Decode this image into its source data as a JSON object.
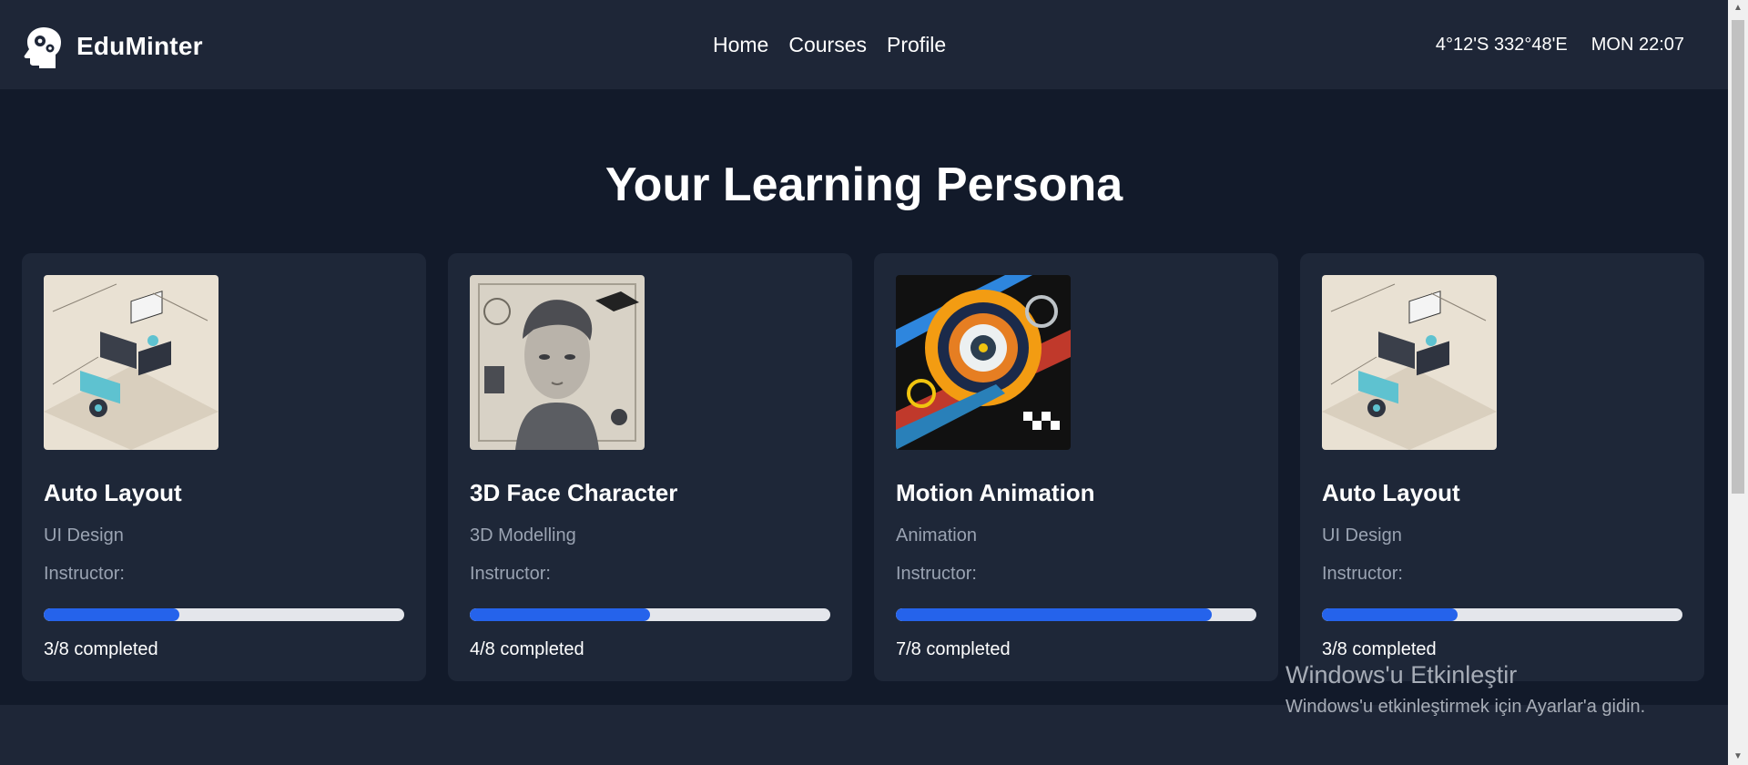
{
  "app": {
    "brand_name": "EduMinter"
  },
  "nav": {
    "links": [
      "Home",
      "Courses",
      "Profile"
    ]
  },
  "status": {
    "coordinates": "4°12'S 332°48'E",
    "day_time": "MON 22:07"
  },
  "page": {
    "title": "Your Learning Persona"
  },
  "courses": [
    {
      "title": "Auto Layout",
      "category": "UI Design",
      "instructor_label": "Instructor:",
      "progress": 0.375,
      "completed_text": "3/8 completed",
      "image": "auto-layout-illustration"
    },
    {
      "title": "3D Face Character",
      "category": "3D Modelling",
      "instructor_label": "Instructor:",
      "progress": 0.5,
      "completed_text": "4/8 completed",
      "image": "3d-face-illustration"
    },
    {
      "title": "Motion Animation",
      "category": "Animation",
      "instructor_label": "Instructor:",
      "progress": 0.875,
      "completed_text": "7/8 completed",
      "image": "motion-animation-illustration"
    },
    {
      "title": "Auto Layout",
      "category": "UI Design",
      "instructor_label": "Instructor:",
      "progress": 0.375,
      "completed_text": "3/8 completed",
      "image": "auto-layout-illustration"
    }
  ],
  "watermark": {
    "title": "Windows'u Etkinleştir",
    "subtitle": "Windows'u etkinleştirmek için Ayarlar'a gidin."
  },
  "colors": {
    "navbar": "#1e2637",
    "background": "#121a2a",
    "card": "#1e2738",
    "accent": "#2563eb",
    "track": "#e4e6eb",
    "muted_text": "#9aa3b2"
  }
}
